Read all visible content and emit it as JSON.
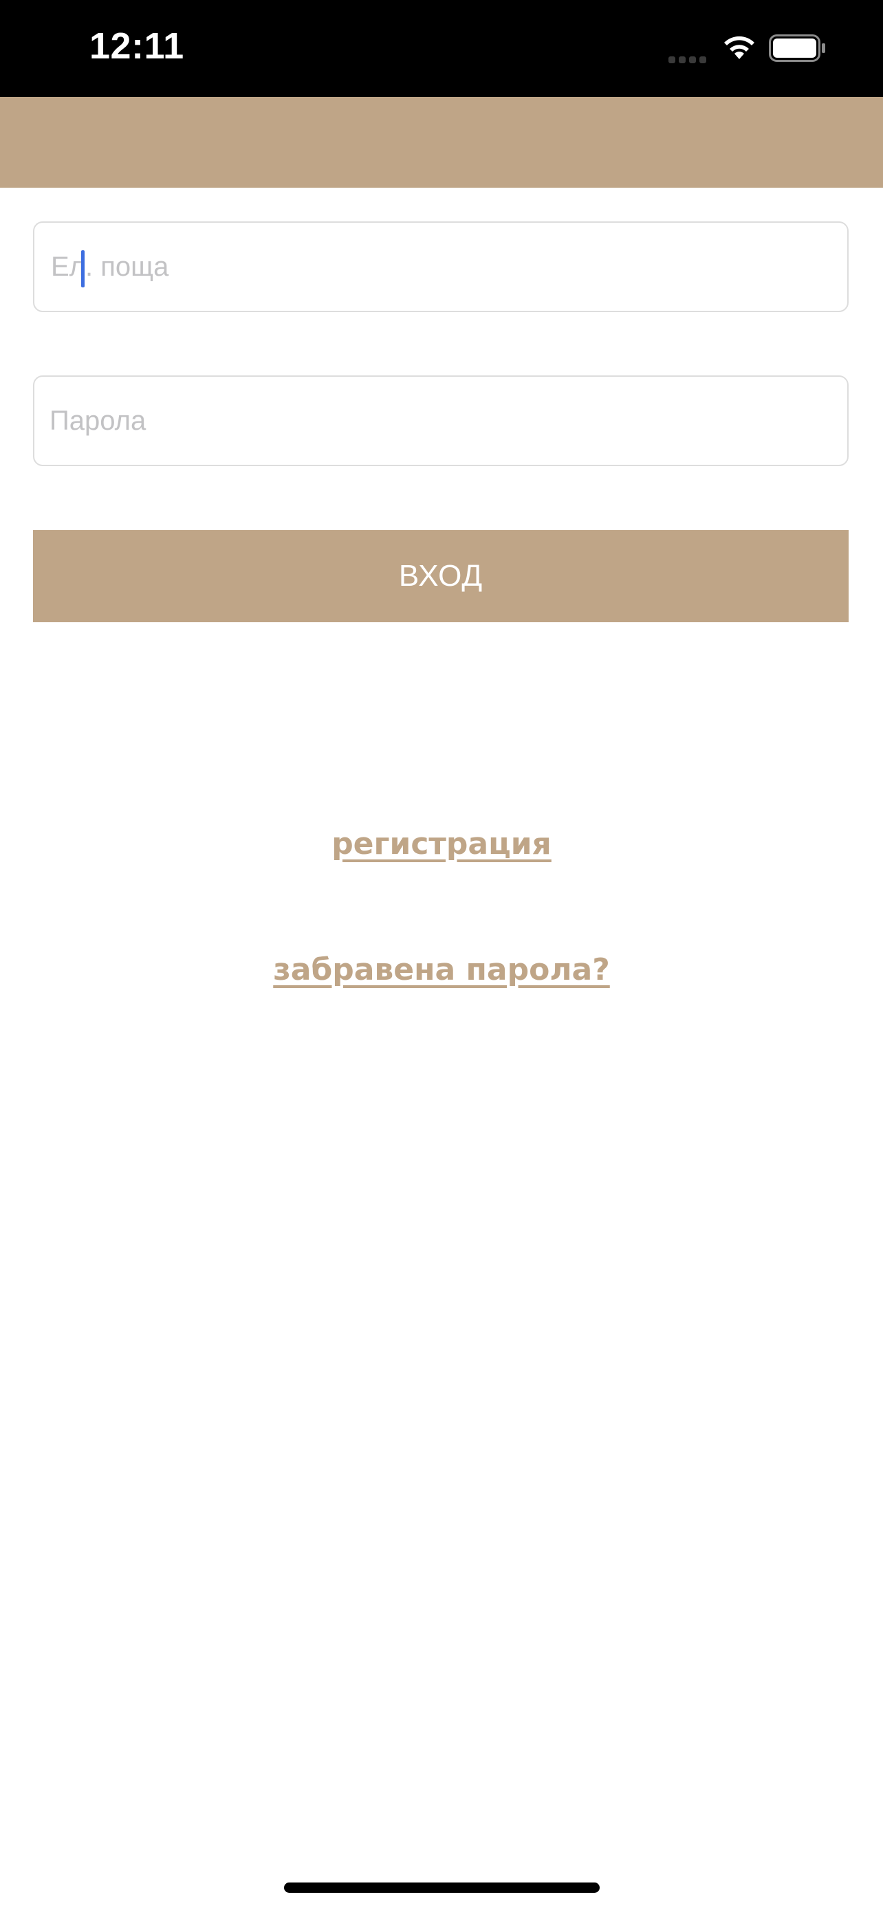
{
  "status_bar": {
    "time": "12:11",
    "icons": [
      "signal-icon",
      "wifi-icon",
      "battery-icon"
    ]
  },
  "colors": {
    "accent": "#bfa587",
    "status_bar_bg": "#000000",
    "background": "#ffffff",
    "cursor": "#3d6ee0"
  },
  "form": {
    "email": {
      "value": "",
      "placeholder": "Ел. поща"
    },
    "password": {
      "value": "",
      "placeholder": "Парола"
    },
    "login_label": "ВХОД"
  },
  "links": {
    "register": "регистрация",
    "forgot_password": "забравена парола?"
  }
}
